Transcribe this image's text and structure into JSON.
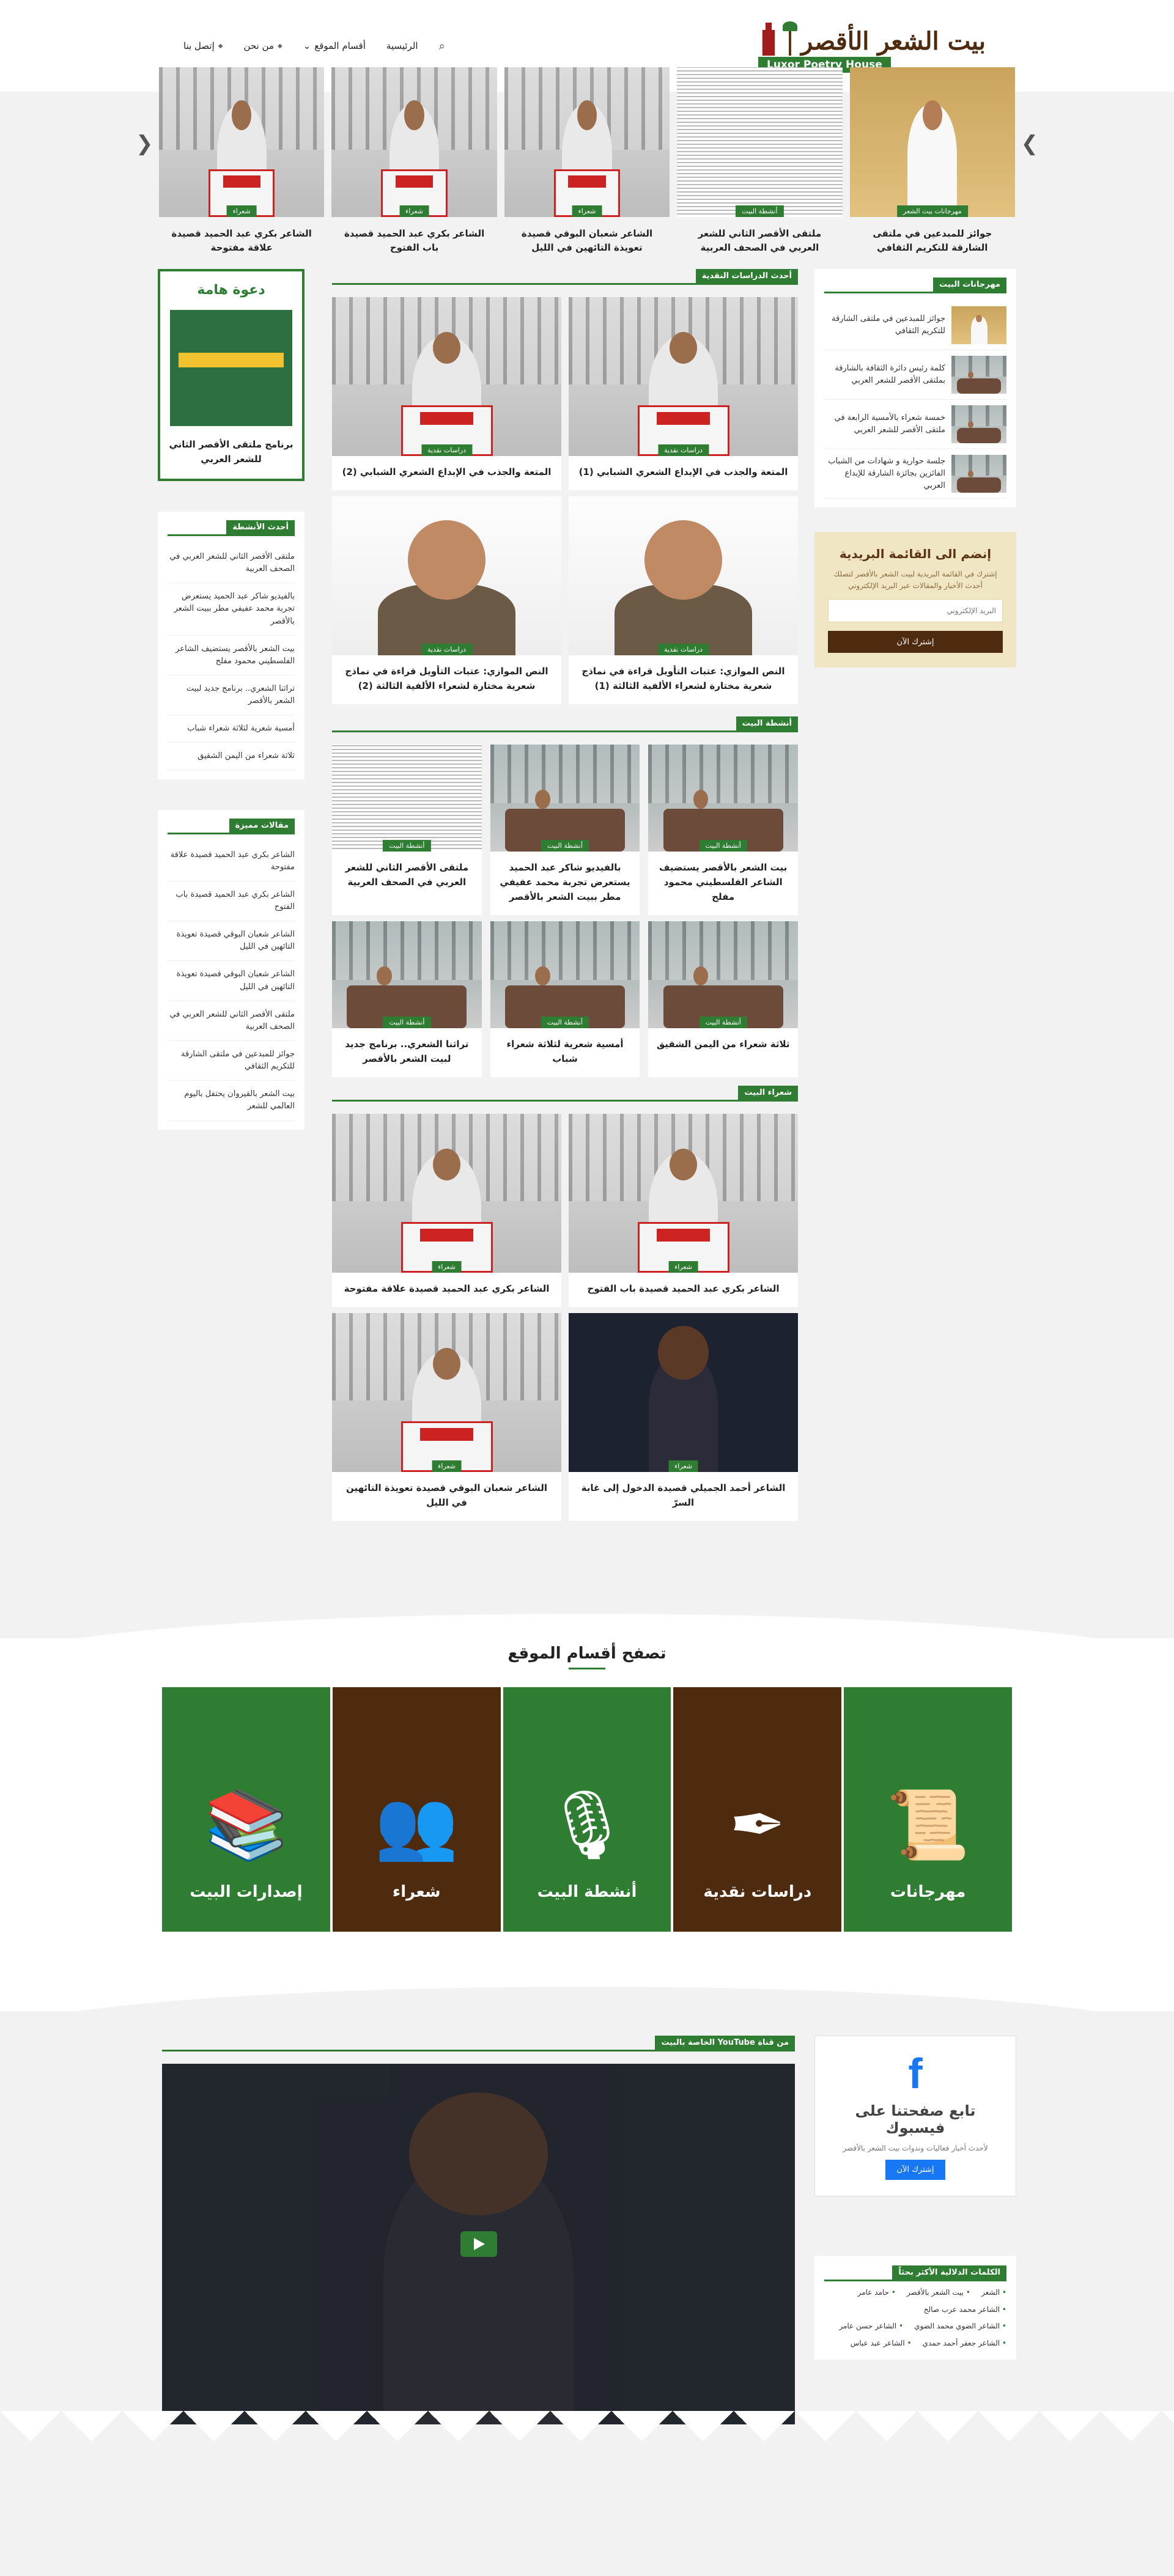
{
  "header": {
    "logo_ar": "بيت الشعر الأقصر",
    "logo_en": "Luxor Poetry House",
    "nav": [
      "الرئيسية",
      "أقسام الموقع",
      "من نحن",
      "إتصل بنا"
    ]
  },
  "slider": [
    {
      "badge": "مهرجانات بيت الشعر",
      "title": "جوائز للمبدعين في ملتقى الشارقة للتكريم الثقافي",
      "img": "sheikh"
    },
    {
      "badge": "أنشطة البيت",
      "title": "ملتقى الأقصر الثاني للشعر العربي في الصحف العربية",
      "img": "paper"
    },
    {
      "badge": "شعراء",
      "title": "الشاعر شعبان البوقي قصيدة تعويذة التائهين في الليل",
      "img": "podium"
    },
    {
      "badge": "شعراء",
      "title": "الشاعر بكري عبد الحميد قصيدة باب الفتوح",
      "img": "podium"
    },
    {
      "badge": "شعراء",
      "title": "الشاعر بكري عبد الحميد قصيدة علاقة مفتوحة",
      "img": "podium"
    }
  ],
  "sections": {
    "critical": {
      "title": "أحدث الدراسات النقدية",
      "posts": [
        {
          "badge": "دراسات نقدية",
          "title": "المتعة والجذب في الإبداع الشعري الشبابي (1)",
          "img": "podium"
        },
        {
          "badge": "دراسات نقدية",
          "title": "المتعة والجذب في الإبداع الشعري الشبابي (2)",
          "img": "podium"
        },
        {
          "badge": "دراسات نقدية",
          "title": "النص الموازي: عتبات التأويل قراءة في نماذج شعرية مختارة لشعراء الألفية الثالثة (1)",
          "img": "portrait"
        },
        {
          "badge": "دراسات نقدية",
          "title": "النص الموازي: عتبات التأويل قراءة في نماذج شعرية مختارة لشعراء الألفية الثالثة (2)",
          "img": "portrait"
        }
      ]
    },
    "activities": {
      "title": "أنشطة البيت",
      "posts": [
        {
          "badge": "أنشطة البيت",
          "title": "بيت الشعر بالأقصر يستضيف الشاعر الفلسطيني محمود مفلح",
          "img": "meeting"
        },
        {
          "badge": "أنشطة البيت",
          "title": "بالفيديو شاكر عبد الحميد يستعرض تجربة محمد عفيفي مطر ببيت الشعر بالأقصر",
          "img": "meeting"
        },
        {
          "badge": "أنشطة البيت",
          "title": "ملتقى الأقصر الثاني للشعر العربي في الصحف العربية",
          "img": "paper"
        },
        {
          "badge": "أنشطة البيت",
          "title": "ثلاثة شعراء من اليمن الشقيق",
          "img": "meeting"
        },
        {
          "badge": "أنشطة البيت",
          "title": "أمسية شعرية لثلاثة شعراء شباب",
          "img": "meeting"
        },
        {
          "badge": "أنشطة البيت",
          "title": "تراثنا الشعري.. برنامج جديد لبيت الشعر بالأقصر",
          "img": "meeting"
        }
      ]
    },
    "poets": {
      "title": "شعراء البيت",
      "posts": [
        {
          "badge": "شعراء",
          "title": "الشاعر بكري عبد الحميد قصيدة باب الفتوح",
          "img": "podium"
        },
        {
          "badge": "شعراء",
          "title": "الشاعر بكري عبد الحميد قصيدة علاقة مفتوحة",
          "img": "podium"
        },
        {
          "badge": "شعراء",
          "title": "الشاعر أحمد الجميلي قصيدة الدخول إلى غابة السرّ",
          "img": "dark"
        },
        {
          "badge": "شعراء",
          "title": "الشاعر شعبان البوقي قصيدة تعويذة التائهين في الليل",
          "img": "podium"
        }
      ]
    }
  },
  "right_sidebar": {
    "festivals": {
      "title": "مهرجانات البيت",
      "items": [
        {
          "title": "جوائز للمبدعين في ملتقى الشارقة للتكريم الثقافي",
          "img": "sheikh"
        },
        {
          "title": "كلمة رئيس دائرة الثقافة بالشارقة بملتقى الأقصر للشعر العربي",
          "img": "meeting"
        },
        {
          "title": "خمسة شعراء بالأمسية الرابعة في ملتقى الأقصر للشعر العربي",
          "img": "meeting"
        },
        {
          "title": "جلسة حوارية و شهادات من الشباب الفائزين بجائزة الشارقة للإبداع العربي",
          "img": "meeting"
        }
      ]
    },
    "newsletter": {
      "title": "إنضم الى القائمة البريدية",
      "text": "إشترك في القائمة البريدية لبيت الشعر بالأقصر لتصلك أحدث الأخبار والمقالات عبر البريد الإلكتروني",
      "placeholder": "البريد الإلكتروني",
      "button": "إشترك الآن"
    }
  },
  "left_sidebar": {
    "invite": {
      "title": "دعوة هامة",
      "caption": "برنامج ملتقى الأقصر الثاني للشعر العربي"
    },
    "latest_activities": {
      "title": "أحدث الأنشطة",
      "items": [
        "ملتقى الأقصر الثاني للشعر العربي في الصحف العربية",
        "بالفيديو شاكر عبد الحميد يستعرض تجربة محمد عفيفي مطر ببيت الشعر بالأقصر",
        "بيت الشعر بالأقصر يستضيف الشاعر الفلسطيني محمود مفلح",
        "تراثنا الشعري.. برنامج جديد لبيت الشعر بالأقصر",
        "أمسية شعرية لثلاثة شعراء شباب",
        "ثلاثة شعراء من اليمن الشقيق"
      ]
    },
    "featured": {
      "title": "مقالات مميزة",
      "items": [
        "الشاعر بكري عبد الحميد قصيدة علاقة مفتوحة",
        "الشاعر بكري عبد الحميد قصيدة باب الفتوح",
        "الشاعر شعبان البوقي قصيدة تعويذة التائهين في الليل",
        "الشاعر شعبان البوقي قصيدة تعويذة التائهين في الليل",
        "ملتقى الأقصر الثاني للشعر العربي في الصحف العربية",
        "جوائز للمبدعين في ملتقى الشارقة للتكريم الثقافي",
        "بيت الشعر بالقيروان يحتفل باليوم العالمي للشعر"
      ]
    }
  },
  "browse": {
    "title": "تصفح أقسام الموقع",
    "tiles": [
      {
        "label": "مهرجانات",
        "icon": "scroll-icon",
        "glyph": "📜",
        "color": "g"
      },
      {
        "label": "دراسات نقدية",
        "icon": "quill-book-icon",
        "glyph": "✒",
        "color": "b"
      },
      {
        "label": "أنشطة البيت",
        "icon": "microphone-icon",
        "glyph": "🎙",
        "color": "g"
      },
      {
        "label": "شعراء",
        "icon": "people-icon",
        "glyph": "👥",
        "color": "b"
      },
      {
        "label": "إصدارات البيت",
        "icon": "books-icon",
        "glyph": "📚",
        "color": "g"
      }
    ]
  },
  "lower": {
    "youtube_title": "من قناة YouTube الخاصة بالبيت",
    "facebook": {
      "title": "تابع صفحتنا على فيسبوك",
      "text": "لأحدث أخبار فعاليات وندوات بيت الشعر بالأقصر",
      "button": "إشترك الآن"
    },
    "tags": {
      "title": "الكلمات الدلالية الأكثر بحثاً",
      "items": [
        "الشعر",
        "بيت الشعر بالأقصر",
        "حامد عامر",
        "الشاعر محمد عرب صالح",
        "الشاعر الضوي محمد الضوي",
        "الشاعر حسن عامر",
        "الشاعر جعفر أحمد حمدي",
        "الشاعر عبد عباس"
      ]
    }
  }
}
